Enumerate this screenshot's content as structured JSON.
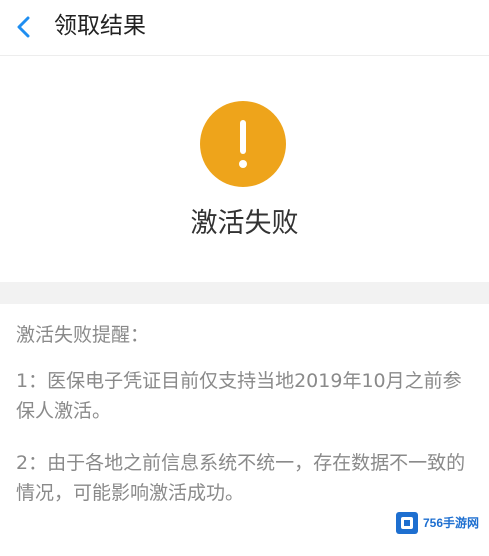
{
  "nav": {
    "back_icon": "chevron-left-icon",
    "title": "领取结果",
    "accent_color": "#1f8ef1"
  },
  "result": {
    "icon": "exclamation-warning-icon",
    "icon_color": "#eea41b",
    "title": "激活失败"
  },
  "tips": {
    "heading": "激活失败提醒：",
    "items": [
      "1：医保电子凭证目前仅支持当地2019年10月之前参保人激活。",
      "2：由于各地之前信息系统不统一，存在数据不一致的情况，可能影响激活成功。"
    ]
  },
  "watermark": {
    "logo": "756-logo",
    "text": "756手游网"
  }
}
